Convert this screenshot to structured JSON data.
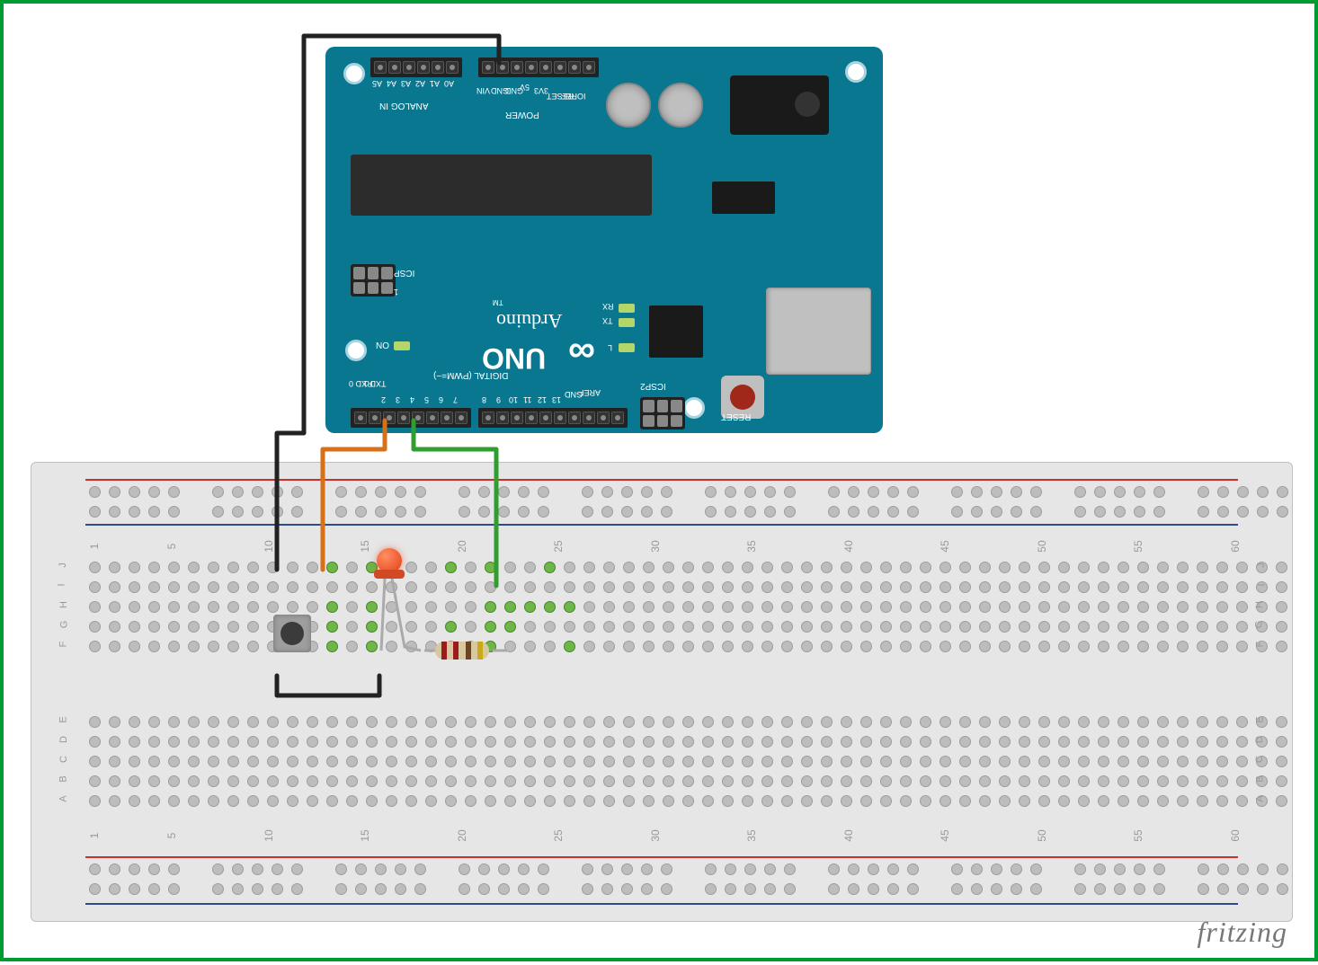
{
  "board": {
    "name": "Arduino UNO",
    "brand": "Arduino",
    "model_label": "UNO",
    "reset_label": "RESET",
    "on_label": "ON",
    "icsp_label": "ICSP",
    "icsp2_label": "ICSP2",
    "analog_section": "ANALOG IN",
    "power_section": "POWER",
    "digital_section": "DIGITAL (PWM=~)",
    "rx_label": "RX",
    "tx_label": "TX",
    "l_label": "L",
    "rx0_label": "RXD 0",
    "tx0_label": "TXD 1",
    "aref_label": "AREF",
    "analog_pins": [
      "A5",
      "A4",
      "A3",
      "A2",
      "A1",
      "A0"
    ],
    "power_pins": [
      "VIN",
      "GND",
      "GND",
      "5V",
      "3V3",
      "RESET",
      "IOREF"
    ],
    "digital_pins_left": [
      "2",
      "3",
      "4",
      "5",
      "6",
      "7"
    ],
    "digital_pins_right": [
      "8",
      "9",
      "10",
      "11",
      "12",
      "13",
      "GND",
      "AREF"
    ]
  },
  "breadboard": {
    "cols_marked": [
      1,
      5,
      10,
      15,
      20,
      25,
      30,
      35,
      40,
      45,
      50,
      55,
      60
    ],
    "row_labels_top": [
      "J",
      "I",
      "H",
      "G",
      "F"
    ],
    "row_labels_bottom": [
      "E",
      "D",
      "C",
      "B",
      "A"
    ]
  },
  "components": {
    "push_button": "Tactile Push Button",
    "led_color": "red",
    "resistor": {
      "value_hint": "220Ω",
      "bands": [
        "#9b1c1c",
        "#9b1c1c",
        "#6b4423",
        "#caa91b"
      ]
    }
  },
  "wires": [
    {
      "name": "gnd-wire-arduino-to-breadboard",
      "color": "#222222"
    },
    {
      "name": "wire-d2-to-button",
      "color": "#d6711a"
    },
    {
      "name": "wire-d4-to-resistor",
      "color": "#2f9e2f"
    },
    {
      "name": "wire-button-to-led-gnd",
      "color": "#222222"
    }
  ],
  "connections": {
    "D2": "Push button (via orange wire)",
    "D4": "Resistor → LED anode (via green wire)",
    "GND": "Breadboard GND rail / button / LED cathode"
  },
  "watermark": "fritzing"
}
